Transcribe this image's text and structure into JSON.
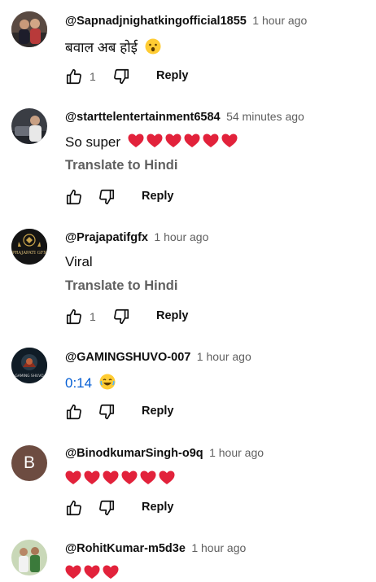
{
  "colors": {
    "heart": "#e2223b",
    "link": "#065fd4",
    "muted": "#606060",
    "avatar_b": "#6d4c41"
  },
  "reply_label": "Reply",
  "comments": [
    {
      "handle": "@Sapnadjnighatkingofficial1855",
      "time": "1 hour ago",
      "text": "बवाल अब होई",
      "emoji": "hushed-face",
      "likes": "1",
      "avatar": "photo-two-people"
    },
    {
      "handle": "@starttelentertainment6584",
      "time": "54 minutes ago",
      "text": "So super",
      "hearts": 6,
      "translate": "Translate to Hindi",
      "avatar": "photo-person-car"
    },
    {
      "handle": "@Prajapatifgfx",
      "time": "1 hour ago",
      "text": "Viral",
      "translate": "Translate to Hindi",
      "likes": "1",
      "avatar": "logo-prajapati-gfx",
      "avatar_text": "PRAJAPATI GFX"
    },
    {
      "handle": "@GAMINGSHUVO-007",
      "time": "1 hour ago",
      "timestamp": "0:14",
      "emoji": "laughing-face",
      "avatar": "logo-gaming-shuvo",
      "avatar_text": "GAMING SHUVO"
    },
    {
      "handle": "@BinodkumarSingh-o9q",
      "time": "1 hour ago",
      "hearts": 6,
      "avatar": "letter",
      "avatar_letter": "B"
    },
    {
      "handle": "@RohitKumar-m5d3e",
      "time": "1 hour ago",
      "hearts": 3,
      "avatar": "photo-people"
    }
  ]
}
